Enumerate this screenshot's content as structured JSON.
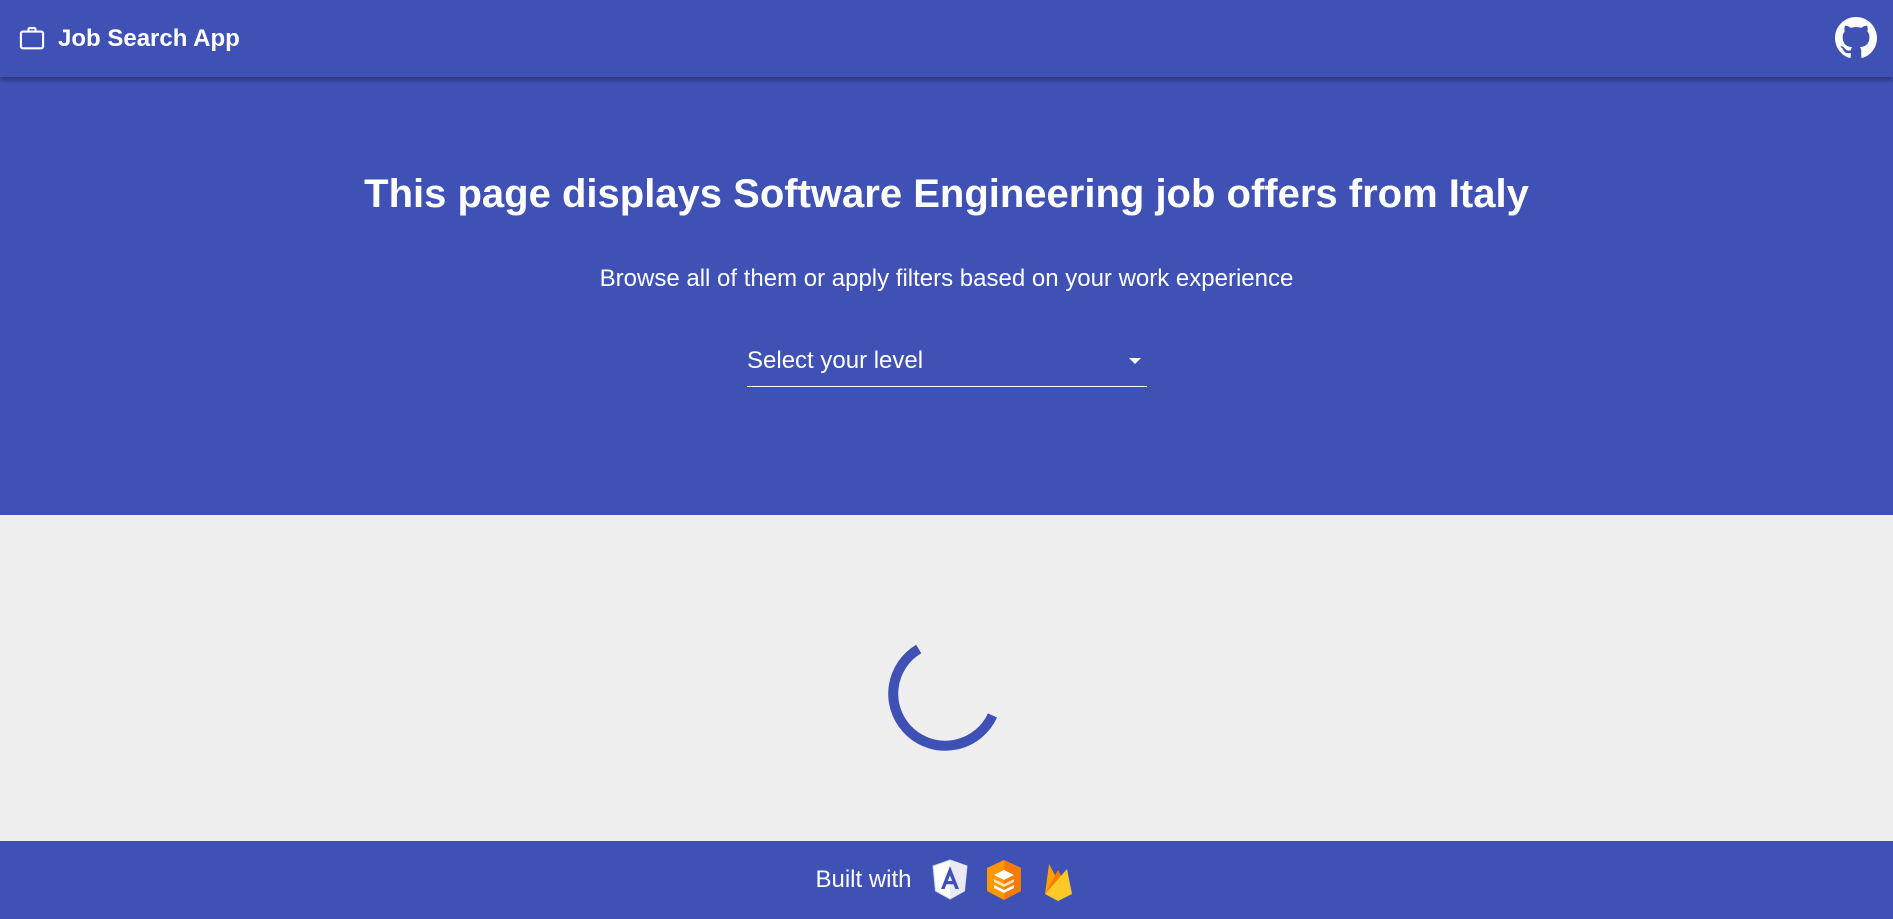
{
  "header": {
    "app_title": "Job Search App",
    "brand_icon": "briefcase-icon",
    "github_icon": "github-icon"
  },
  "hero": {
    "title": "This page displays Software Engineering job offers from Italy",
    "subtitle": "Browse all of them or apply filters based on your work experience",
    "level_select": {
      "placeholder": "Select your level",
      "icon": "chevron-down-icon"
    }
  },
  "content": {
    "loading": true,
    "spinner_icon": "loading-spinner"
  },
  "footer": {
    "built_with": "Built with",
    "tech_icons": [
      "angular-icon",
      "angular-material-icon",
      "firebase-icon"
    ]
  },
  "colors": {
    "primary": "#3f51b5",
    "background": "#eeeeee",
    "text_on_primary": "#ffffff",
    "angular_red": "#dd0031",
    "material_orange": "#ff9800",
    "firebase_yellow": "#ffca28"
  }
}
